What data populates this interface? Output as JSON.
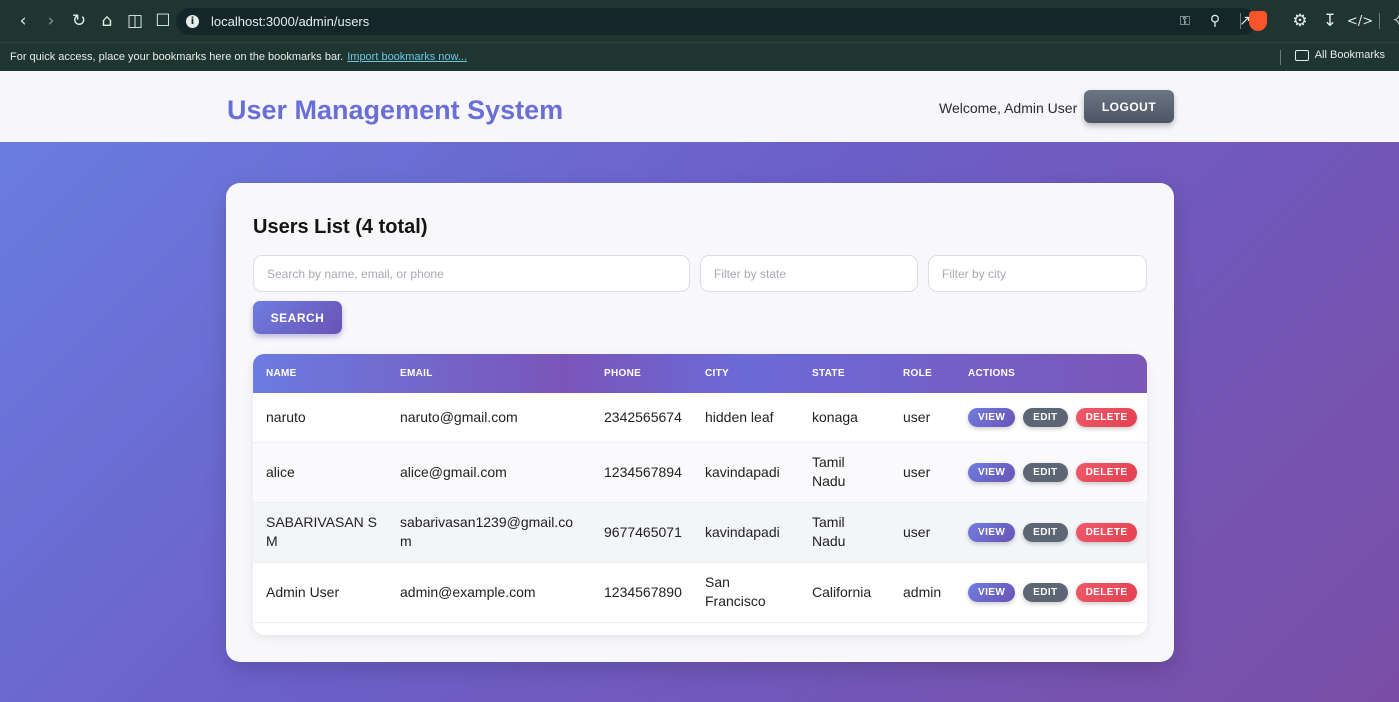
{
  "browser": {
    "url": "localhost:3000/admin/users",
    "bookmarks_prompt": "For quick access, place your bookmarks here on the bookmarks bar.",
    "import_link": "Import bookmarks now...",
    "all_bookmarks": "All Bookmarks"
  },
  "header": {
    "title": "User Management System",
    "welcome": "Welcome, Admin User",
    "logout_label": "LOGOUT"
  },
  "users_card": {
    "title": "Users List (4 total)",
    "search_placeholder": "Search by name, email, or phone",
    "state_placeholder": "Filter by state",
    "city_placeholder": "Filter by city",
    "search_label": "SEARCH"
  },
  "table": {
    "headers": [
      "NAME",
      "EMAIL",
      "PHONE",
      "CITY",
      "STATE",
      "ROLE",
      "ACTIONS"
    ],
    "action_labels": {
      "view": "VIEW",
      "edit": "EDIT",
      "delete": "DELETE"
    },
    "rows": [
      {
        "name": "naruto",
        "email": "naruto@gmail.com",
        "phone": "2342565674",
        "city": "hidden leaf",
        "state": "konaga",
        "role": "user"
      },
      {
        "name": "alice",
        "email": "alice@gmail.com",
        "phone": "1234567894",
        "city": "kavindapadi",
        "state": "Tamil Nadu",
        "role": "user"
      },
      {
        "name": "SABARIVASAN S M",
        "email": "sabarivasan1239@gmail.com",
        "phone": "9677465071",
        "city": "kavindapadi",
        "state": "Tamil Nadu",
        "role": "user"
      },
      {
        "name": "Admin User",
        "email": "admin@example.com",
        "phone": "1234567890",
        "city": "San Francisco",
        "state": "California",
        "role": "admin"
      }
    ]
  },
  "colors": {
    "accent": "#6a6fd6",
    "delete": "#e2404f",
    "edit": "#5d6674"
  }
}
